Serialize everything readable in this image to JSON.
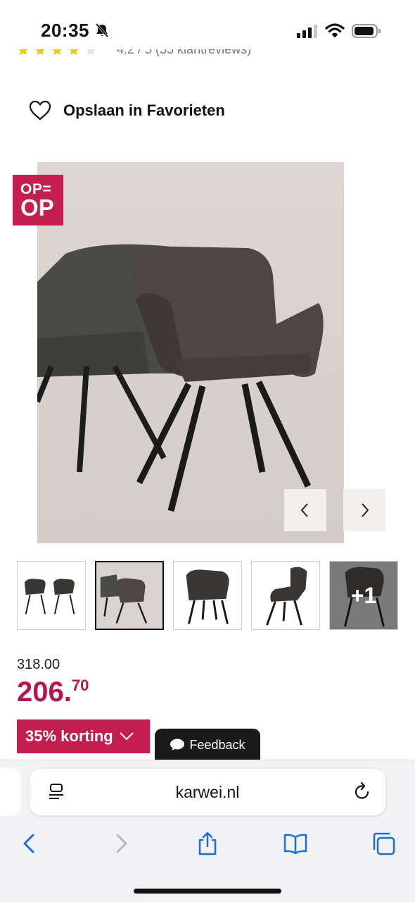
{
  "status_bar": {
    "time": "20:35"
  },
  "rating": {
    "text": "4.2 / 5 (55 klantreviews)"
  },
  "favorites": {
    "label": "Opslaan in Favorieten"
  },
  "badge": {
    "line1": "OP=",
    "line2": "OP"
  },
  "thumbnails": {
    "more_label": "+1"
  },
  "price": {
    "old": "318.00",
    "new_main": "206.",
    "new_cents": "70"
  },
  "discount": {
    "label": "35% korting"
  },
  "feedback": {
    "label": "Feedback"
  },
  "browser": {
    "url": "karwei.nl"
  },
  "colors": {
    "brand": "#c41e4e",
    "price": "#b5174a",
    "ios_blue": "#1a6fd6"
  }
}
